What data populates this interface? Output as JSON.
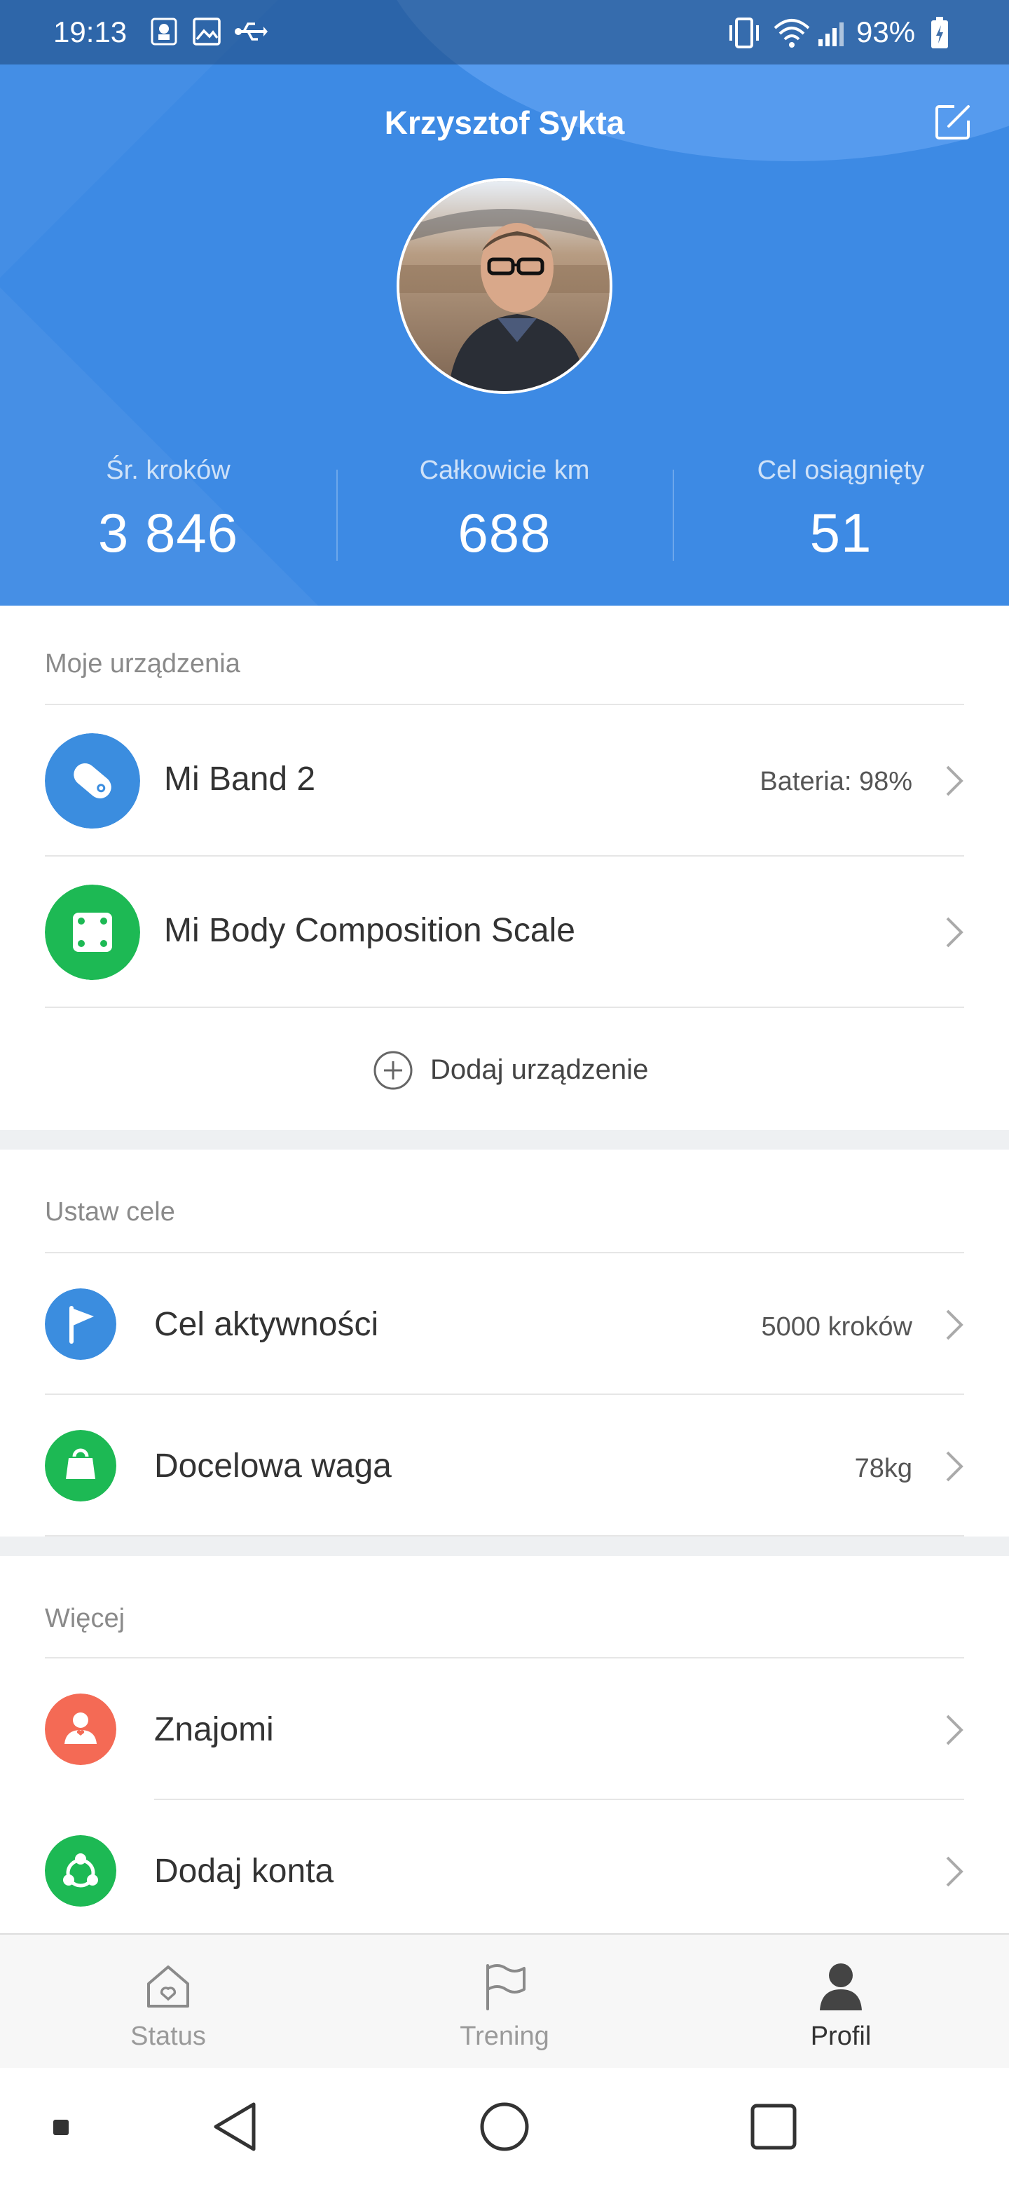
{
  "status_bar": {
    "time": "19:13",
    "battery_percent": "93%",
    "icons": [
      "scissors-notification-icon",
      "image-notification-icon",
      "usb-icon",
      "vibrate-icon",
      "wifi-icon",
      "signal-icon",
      "battery-icon"
    ]
  },
  "profile": {
    "name": "Krzysztof Sykta",
    "edit_icon": "edit-icon",
    "stats": [
      {
        "label": "Śr. kroków",
        "value": "3 846"
      },
      {
        "label": "Całkowicie km",
        "value": "688"
      },
      {
        "label": "Cel osiągnięty",
        "value": "51"
      }
    ]
  },
  "devices": {
    "title": "Moje urządzenia",
    "items": [
      {
        "name": "Mi Band 2",
        "detail": "Bateria: 98%",
        "icon": "band-icon",
        "color": "#3b8ddf"
      },
      {
        "name": "Mi Body Composition Scale",
        "detail": "",
        "icon": "scale-icon",
        "color": "#1db954"
      }
    ],
    "add_label": "Dodaj urządzenie"
  },
  "goals": {
    "title": "Ustaw cele",
    "items": [
      {
        "name": "Cel aktywności",
        "detail": "5000 kroków",
        "icon": "flag-icon",
        "color": "#3b8ddf"
      },
      {
        "name": "Docelowa waga",
        "detail": "78kg",
        "icon": "weight-icon",
        "color": "#1db954"
      }
    ]
  },
  "more": {
    "title": "Więcej",
    "items": [
      {
        "name": "Znajomi",
        "detail": "",
        "icon": "friends-icon",
        "color": "#f46a55"
      },
      {
        "name": "Dodaj konta",
        "detail": "",
        "icon": "accounts-icon",
        "color": "#1db954"
      }
    ]
  },
  "tabs": [
    {
      "label": "Status",
      "icon": "home-icon",
      "active": false
    },
    {
      "label": "Trening",
      "icon": "flag-outline-icon",
      "active": false
    },
    {
      "label": "Profil",
      "icon": "person-icon",
      "active": true
    }
  ],
  "nav": [
    "menu-dot-icon",
    "back-icon",
    "home-circle-icon",
    "recents-icon"
  ]
}
